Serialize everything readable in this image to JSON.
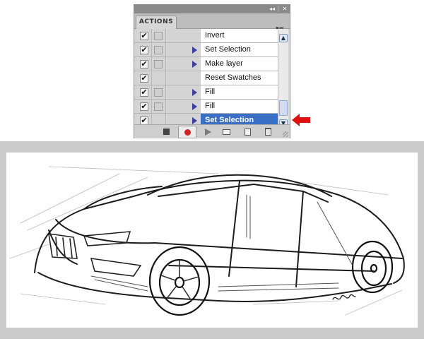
{
  "panel": {
    "tab_label": "ACTIONS",
    "collapse_glyph": "◂◂",
    "close_glyph": "✕",
    "menu_glyph": "▾≡",
    "rows": [
      {
        "checked": true,
        "dialog_box": true,
        "expandable": false,
        "label": "Invert",
        "selected": false
      },
      {
        "checked": true,
        "dialog_box": true,
        "expandable": true,
        "label": "Set Selection",
        "selected": false
      },
      {
        "checked": true,
        "dialog_box": true,
        "expandable": true,
        "label": "Make layer",
        "selected": false
      },
      {
        "checked": true,
        "dialog_box": false,
        "expandable": false,
        "label": "Reset Swatches",
        "selected": false
      },
      {
        "checked": true,
        "dialog_box": true,
        "expandable": true,
        "label": "Fill",
        "selected": false
      },
      {
        "checked": true,
        "dialog_box": true,
        "expandable": true,
        "label": "Fill",
        "selected": false
      },
      {
        "checked": true,
        "dialog_box": false,
        "expandable": true,
        "label": "Set Selection",
        "selected": true
      }
    ],
    "check_glyph": "✔",
    "scroll_up_glyph": "▲",
    "scroll_down_glyph": "▼",
    "bottom_buttons": [
      "stop-recording",
      "begin-recording",
      "play-selection",
      "create-new-set",
      "create-new-action",
      "delete"
    ]
  },
  "colors": {
    "selection": "#3a6fc6",
    "arrow": "#e01010",
    "record": "#d22222"
  },
  "artwork": {
    "signature": "Shed"
  }
}
